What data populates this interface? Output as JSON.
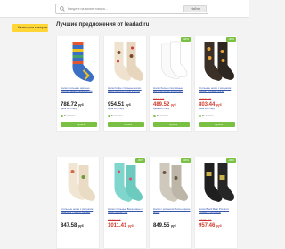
{
  "search": {
    "placeholder": "Введите название товара...",
    "button_label": "Найти"
  },
  "sidebar": {
    "categories_label": "Категории товаров"
  },
  "main": {
    "title": "Лучшие предложения от leadad.ru"
  },
  "colors": {
    "accent_green": "#7ac143",
    "category_yellow": "#ffd633",
    "sale_red": "#d03a2b"
  },
  "products": [
    {
      "name": "Носки стильные цветные Пиццы, акварельные носки",
      "old_price": "",
      "price": "788.72",
      "currency": "руб",
      "badge": "",
      "sub": "Цена за 1 пару",
      "availability": "В наличии",
      "buy_label": "Купить",
      "art": "colorful"
    },
    {
      "name": "Носки Кофе стильные носки, яркие носки в стиле Pop Art",
      "old_price": "",
      "price": "954.51",
      "currency": "руб",
      "badge": "",
      "sub": "Цена за 1 пару",
      "availability": "В наличии",
      "buy_label": "Купить",
      "art": "beige"
    },
    {
      "name": "Носки белые спортивные, высокие носки для спорта",
      "old_price": "700.00",
      "price": "489.52",
      "currency": "руб",
      "badge": "-30%",
      "sub": "Цена за 1 пару",
      "availability": "В наличии",
      "buy_label": "Купить",
      "art": "white"
    },
    {
      "name": "Стильные носки с рисунком Пицца, крупные носки",
      "old_price": "1150.00",
      "price": "803.44",
      "currency": "руб",
      "badge": "-30%",
      "sub": "Цена за 1 пару",
      "availability": "В наличии",
      "buy_label": "Купить",
      "art": "dark"
    },
    {
      "name": "Стильные носки с рисунком Акварель с аксессуарами",
      "old_price": "",
      "price": "847.58",
      "currency": "руб",
      "badge": "",
      "sub": "",
      "availability": "",
      "buy_label": "",
      "art": "cream"
    },
    {
      "name": "Носки стильные Бирюзовые с принтом Кактусы",
      "old_price": "1450.00",
      "price": "1011.41",
      "currency": "руб",
      "badge": "-30%",
      "sub": "",
      "availability": "",
      "buy_label": "",
      "art": "teal"
    },
    {
      "name": "Носки с рисунком Мопсы, яркие носки",
      "old_price": "",
      "price": "849.55",
      "currency": "руб",
      "badge": "-30%",
      "sub": "",
      "availability": "",
      "buy_label": "",
      "art": "grey"
    },
    {
      "name": "Носки Black Bear Premium чёрные с рисунком",
      "old_price": "1370.00",
      "price": "957.46",
      "currency": "руб",
      "badge": "-30%",
      "sub": "",
      "availability": "",
      "buy_label": "",
      "art": "black"
    }
  ]
}
